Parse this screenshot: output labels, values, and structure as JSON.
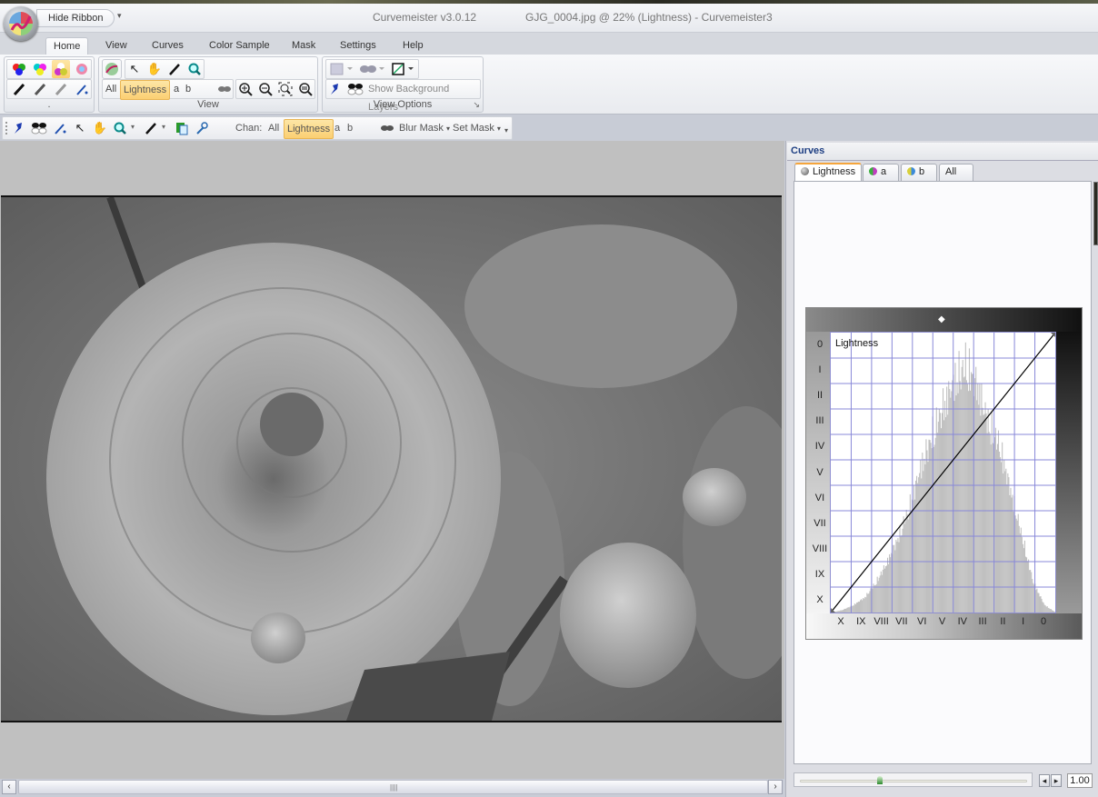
{
  "window": {
    "app_title": "Curvemeister v3.0.12",
    "document_title": "GJG_0004.jpg @ 22% (Lightness) -  Curvemeister3"
  },
  "quick_access": {
    "hide_ribbon_label": "Hide Ribbon",
    "dropdown_glyph": "▾"
  },
  "ribbon_tabs": [
    {
      "label": "Home",
      "active": true
    },
    {
      "label": "View",
      "active": false
    },
    {
      "label": "Curves",
      "active": false
    },
    {
      "label": "Color Sample",
      "active": false
    },
    {
      "label": "Mask",
      "active": false
    },
    {
      "label": "Settings",
      "active": false
    },
    {
      "label": "Help",
      "active": false
    }
  ],
  "ribbon_groups": {
    "group1": {
      "label": ".",
      "row1_icons": [
        "rgb-circles-icon",
        "cmy-circles-icon",
        "lab-circles-icon",
        "color-wheel-icon"
      ],
      "row2_icons": [
        "black-eyedropper-icon",
        "gray-eyedropper-icon",
        "white-eyedropper-icon",
        "magic-wand-icon"
      ]
    },
    "view": {
      "label": "View",
      "row1_icons": [
        "curve-app-icon",
        "pointer-icon",
        "hand-icon",
        "eyedropper-icon",
        "magnifier-icon"
      ],
      "channels": [
        "All",
        "Lightness",
        "a",
        "b"
      ],
      "active_channel": "Lightness",
      "row2_icons": [
        "blur-mask-icon",
        "zoom-in-icon",
        "zoom-out-icon",
        "zoom-fit-icon",
        "zoom-actual-icon"
      ]
    },
    "view_options": {
      "label": "View Options",
      "row1_icons": [
        "background-icon",
        "mask-icon",
        "curve-display-icon"
      ],
      "show_background_layers": "Show Background Layers",
      "launcher_glyph": "↘"
    }
  },
  "toolbar2": {
    "chan_label": "Chan:",
    "channels": [
      "All",
      "Lightness",
      "a",
      "b"
    ],
    "active_channel": "Lightness",
    "blur_mask": "Blur Mask",
    "set_mask": "Set Mask",
    "icons": [
      "pin-icon",
      "mask-glasses-icon",
      "magic-wand-icon",
      "pointer-icon",
      "hand-icon",
      "magnifier-icon",
      "eyedropper-icon",
      "copy-icon",
      "wrench-icon"
    ]
  },
  "image": {
    "subject": "grayscale photo of a dahlia flower with buds"
  },
  "curves_panel": {
    "title": "Curves",
    "tabs": [
      {
        "label": "Lightness",
        "color": "#7a7a7a",
        "active": true
      },
      {
        "label": "a",
        "color": "#c03cc0",
        "active": false
      },
      {
        "label": "b",
        "color": "#3c8ad8",
        "active": false
      },
      {
        "label": "All",
        "color": "",
        "active": false
      }
    ],
    "slider_value": "1.00",
    "slider_fraction": 0.34
  },
  "chart_data": {
    "type": "line",
    "title": "Lightness",
    "xlabel": "",
    "ylabel": "",
    "x_tick_labels": [
      "X",
      "IX",
      "VIII",
      "VII",
      "VI",
      "V",
      "IV",
      "III",
      "II",
      "I",
      "0"
    ],
    "y_tick_labels": [
      "0",
      "I",
      "II",
      "III",
      "IV",
      "V",
      "VI",
      "VII",
      "VIII",
      "IX",
      "X"
    ],
    "xlim": [
      0,
      100
    ],
    "ylim": [
      0,
      100
    ],
    "grid": true,
    "series": [
      {
        "name": "Lightness curve",
        "x": [
          0,
          100
        ],
        "y": [
          0,
          100
        ],
        "color": "#000000"
      }
    ],
    "histogram": {
      "bins_x": [
        0,
        5,
        10,
        15,
        20,
        25,
        30,
        35,
        40,
        45,
        50,
        55,
        60,
        65,
        70,
        75,
        80,
        85,
        90,
        95,
        100
      ],
      "heights": [
        0,
        1,
        3,
        6,
        12,
        20,
        30,
        42,
        58,
        70,
        82,
        92,
        98,
        90,
        75,
        66,
        48,
        30,
        12,
        3,
        0
      ],
      "color": "#c0c0c0"
    },
    "grid_color": "#8888d8"
  }
}
